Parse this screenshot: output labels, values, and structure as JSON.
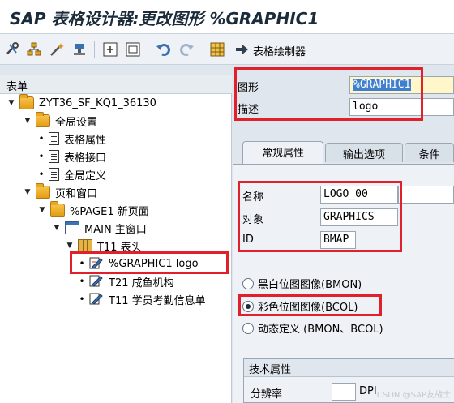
{
  "window": {
    "title": "SAP 表格设计器:更改图形 %GRAPHIC1"
  },
  "toolbar": {
    "table_painter_label": "表格绘制器",
    "icons": [
      "tools-icon",
      "hierarchy-icon",
      "wand-icon",
      "stamp-icon",
      "window-add-icon",
      "window-edit-icon",
      "undo-icon",
      "redo-icon",
      "grid-icon",
      "arrow-right-icon"
    ]
  },
  "tree": {
    "header": "表单",
    "items": [
      {
        "label": "ZYT36_SF_KQ1_36130",
        "icon": "folder-icon"
      },
      {
        "label": "全局设置",
        "icon": "folder-icon"
      },
      {
        "label": "表格属性",
        "icon": "document-icon"
      },
      {
        "label": "表格接口",
        "icon": "document-icon"
      },
      {
        "label": "全局定义",
        "icon": "document-icon"
      },
      {
        "label": "页和窗口",
        "icon": "folder-icon"
      },
      {
        "label": "%PAGE1 新页面",
        "icon": "folder-icon"
      },
      {
        "label": "MAIN 主窗口",
        "icon": "window-icon"
      },
      {
        "label": "T11 表头",
        "icon": "table-icon"
      },
      {
        "label": "%GRAPHIC1 logo",
        "icon": "graphic-edit-icon"
      },
      {
        "label": "T21 咸鱼机构",
        "icon": "text-edit-icon"
      },
      {
        "label": "T11 学员考勤信息单",
        "icon": "text-edit-icon"
      }
    ]
  },
  "header_fields": {
    "graphic_label": "图形",
    "graphic_value": "%GRAPHIC1",
    "description_label": "描述",
    "description_value": "logo"
  },
  "tabs": [
    "常规属性",
    "输出选项",
    "条件"
  ],
  "general": {
    "name_label": "名称",
    "name_value": "LOGO_00",
    "object_label": "对象",
    "object_value": "GRAPHICS",
    "id_label": "ID",
    "id_value": "BMAP"
  },
  "radio_options": [
    {
      "label": "黑白位图图像(BMON)",
      "selected": false
    },
    {
      "label": "彩色位图图像(BCOL)",
      "selected": true
    },
    {
      "label": "动态定义 (BMON、BCOL)",
      "selected": false
    }
  ],
  "tech": {
    "title": "技术属性",
    "resolution_label": "分辨率",
    "resolution_value": "",
    "unit": "DPI"
  },
  "watermark": "CSDN @SAP友战士",
  "colors": {
    "highlight": "#e0202a",
    "selected_field_bg": "#3f7fd0"
  }
}
